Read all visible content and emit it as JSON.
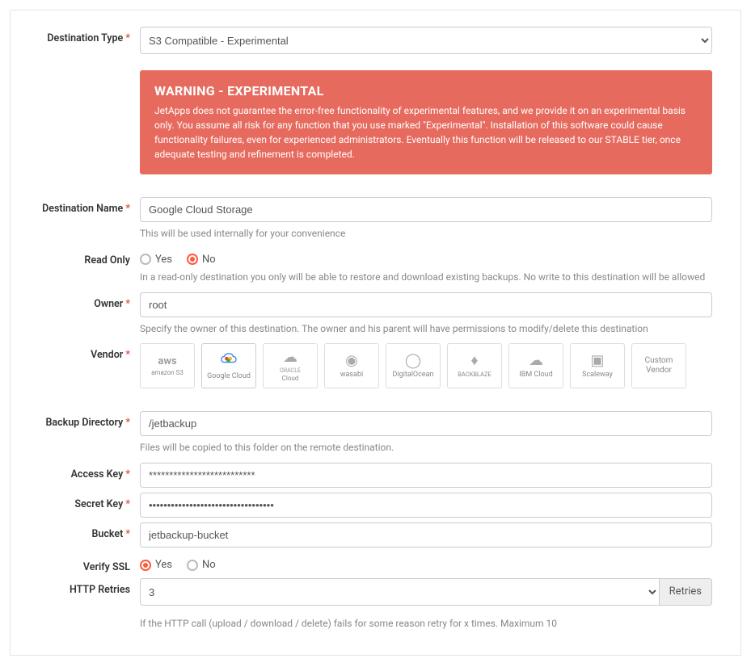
{
  "destinationType": {
    "label": "Destination Type",
    "required": "*",
    "value": "S3 Compatible - Experimental"
  },
  "warning": {
    "title": "WARNING - EXPERIMENTAL",
    "body": "JetApps does not guarantee the error-free functionality of experimental features, and we provide it on an experimental basis only. You assume all risk for any function that you use marked \"Experimental\". Installation of this software could cause functionality failures, even for experienced administrators. Eventually this function will be released to our STABLE tier, once adequate testing and refinement is completed."
  },
  "destinationName": {
    "label": "Destination Name",
    "required": "*",
    "value": "Google Cloud Storage",
    "help": "This will be used internally for your convenience"
  },
  "readOnly": {
    "label": "Read Only",
    "yes": "Yes",
    "no": "No",
    "help": "In a read-only destination you only will be able to restore and download existing backups. No write to this destination will be allowed"
  },
  "owner": {
    "label": "Owner",
    "required": "*",
    "value": "root",
    "help": "Specify the owner of this destination. The owner and his parent will have permissions to modify/delete this destination"
  },
  "vendor": {
    "label": "Vendor",
    "required": "*",
    "items": [
      {
        "id": "amazon-s3",
        "name": "amazon S3"
      },
      {
        "id": "google-cloud",
        "name": "Google Cloud"
      },
      {
        "id": "oracle-cloud",
        "name": "Cloud"
      },
      {
        "id": "wasabi",
        "name": "wasabi"
      },
      {
        "id": "digitalocean",
        "name": "DigitalOcean"
      },
      {
        "id": "backblaze",
        "name": "BACKBLAZE"
      },
      {
        "id": "ibm-cloud",
        "name": "IBM Cloud"
      },
      {
        "id": "scaleway",
        "name": "Scaleway"
      },
      {
        "id": "custom",
        "name": "Custom Vendor"
      }
    ]
  },
  "backupDir": {
    "label": "Backup Directory",
    "required": "*",
    "value": "/jetbackup",
    "help": "Files will be copied to this folder on the remote destination."
  },
  "accessKey": {
    "label": "Access Key",
    "required": "*",
    "value": "**************************"
  },
  "secretKey": {
    "label": "Secret Key",
    "required": "*",
    "value": "••••••••••••••••••••••••••••••••••"
  },
  "bucket": {
    "label": "Bucket",
    "required": "*",
    "value": "jetbackup-bucket"
  },
  "verifySSL": {
    "label": "Verify SSL",
    "yes": "Yes",
    "no": "No"
  },
  "httpRetries": {
    "label": "HTTP Retries",
    "value": "3",
    "addon": "Retries",
    "help": "If the HTTP call (upload / download / delete) fails for some reason retry for x times. Maximum 10"
  }
}
